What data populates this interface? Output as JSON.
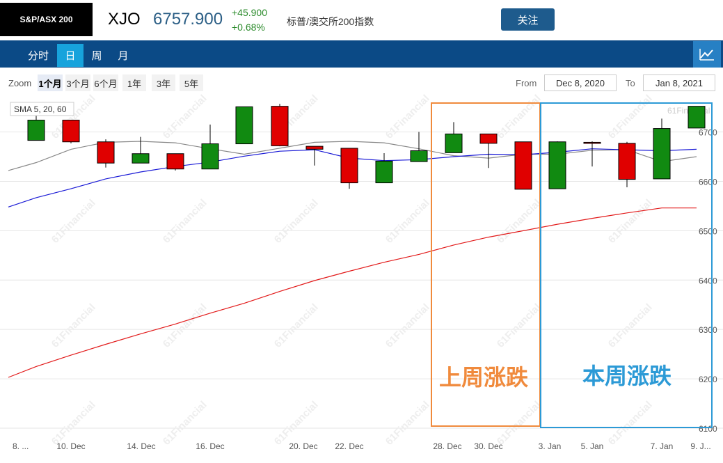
{
  "header": {
    "badge": "S&P/ASX 200",
    "symbol": "XJO",
    "price": "6757.900",
    "change": "+45.900",
    "change_pct": "+0.68%",
    "name": "标普/澳交所200指数",
    "follow_label": "关注"
  },
  "tabs": [
    "分时",
    "日",
    "周",
    "月"
  ],
  "active_tab": "日",
  "zoom": {
    "label": "Zoom",
    "options": [
      "1个月",
      "3个月",
      "6个月",
      "1年",
      "3年",
      "5年"
    ],
    "selected": "1个月"
  },
  "range": {
    "from_label": "From",
    "from": "Dec 8, 2020",
    "to_label": "To",
    "to": "Jan 8, 2021"
  },
  "legend_box": "SMA 5, 20, 60",
  "watermark": "61Financial",
  "annotations": {
    "last_week": "上周涨跌",
    "this_week": "本周涨跌"
  },
  "colors": {
    "up": "#118a11",
    "down": "#e00000",
    "sma5": "#888888",
    "sma20": "#1a1ad6",
    "sma60": "#e21a1a",
    "last_week_box": "#f08a3c",
    "this_week_box": "#2c9ad6",
    "nav": "#0b4a86"
  },
  "chart_data": {
    "type": "candlestick",
    "ylim": [
      6100,
      6760
    ],
    "yticks": [
      6100,
      6200,
      6300,
      6400,
      6500,
      6600,
      6700
    ],
    "x_ticks": [
      "8. ...",
      "10. Dec",
      "14. Dec",
      "16. Dec",
      "20. Dec",
      "22. Dec",
      "28. Dec",
      "30. Dec",
      "3. Jan",
      "5. Jan",
      "7. Jan",
      "9. J..."
    ],
    "candles": [
      {
        "open": 6683,
        "high": 6738,
        "low": 6683,
        "close": 6724
      },
      {
        "open": 6724,
        "high": 6724,
        "low": 6677,
        "close": 6680
      },
      {
        "open": 6680,
        "high": 6685,
        "low": 6628,
        "close": 6637
      },
      {
        "open": 6637,
        "high": 6690,
        "low": 6637,
        "close": 6656
      },
      {
        "open": 6656,
        "high": 6656,
        "low": 6622,
        "close": 6625
      },
      {
        "open": 6625,
        "high": 6715,
        "low": 6625,
        "close": 6676
      },
      {
        "open": 6676,
        "high": 6751,
        "low": 6676,
        "close": 6751
      },
      {
        "open": 6752,
        "high": 6757,
        "low": 6671,
        "close": 6672
      },
      {
        "open": 6671,
        "high": 6671,
        "low": 6632,
        "close": 6665
      },
      {
        "open": 6667,
        "high": 6667,
        "low": 6585,
        "close": 6597
      },
      {
        "open": 6597,
        "high": 6657,
        "low": 6597,
        "close": 6641
      },
      {
        "open": 6640,
        "high": 6700,
        "low": 6640,
        "close": 6662
      },
      {
        "open": 6658,
        "high": 6720,
        "low": 6658,
        "close": 6696
      },
      {
        "open": 6696,
        "high": 6696,
        "low": 6627,
        "close": 6677
      },
      {
        "open": 6680,
        "high": 6680,
        "low": 6584,
        "close": 6584
      },
      {
        "open": 6585,
        "high": 6681,
        "low": 6585,
        "close": 6680
      },
      {
        "open": 6679,
        "high": 6681,
        "low": 6630,
        "close": 6677
      },
      {
        "open": 6677,
        "high": 6680,
        "low": 6588,
        "close": 6604
      },
      {
        "open": 6605,
        "high": 6727,
        "low": 6605,
        "close": 6707
      },
      {
        "open": 6708,
        "high": 6752,
        "low": 6708,
        "close": 6752
      }
    ],
    "series": [
      {
        "name": "SMA 5",
        "values": [
          6622,
          6638,
          6665,
          6679,
          6681,
          6678,
          6666,
          6655,
          6667,
          6679,
          6681,
          6678,
          6666,
          6652,
          6647,
          6655,
          6655,
          6663,
          6664,
          6640,
          6650
        ]
      },
      {
        "name": "SMA 20",
        "values": [
          6548,
          6567,
          6585,
          6605,
          6619,
          6630,
          6639,
          6651,
          6661,
          6664,
          6647,
          6642,
          6644,
          6650,
          6655,
          6654,
          6659,
          6666,
          6664,
          6662,
          6665
        ]
      },
      {
        "name": "SMA 60",
        "values": [
          6203,
          6225,
          6248,
          6270,
          6291,
          6311,
          6333,
          6353,
          6377,
          6399,
          6418,
          6436,
          6452,
          6471,
          6487,
          6500,
          6513,
          6525,
          6536,
          6546,
          6546
        ]
      }
    ]
  }
}
